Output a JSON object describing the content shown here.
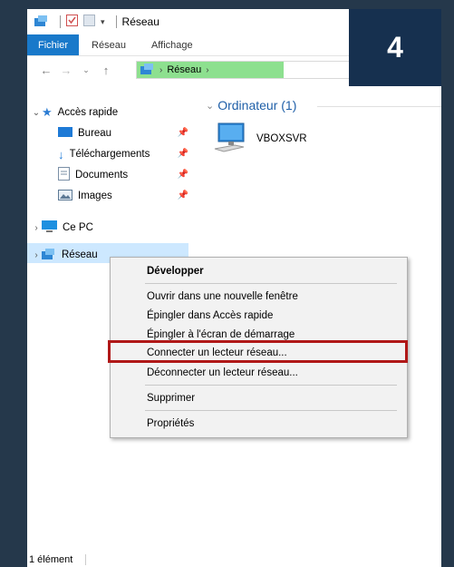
{
  "window": {
    "title": "Réseau"
  },
  "ribbon": {
    "tabs": [
      "Fichier",
      "Réseau",
      "Affichage"
    ]
  },
  "address": {
    "segments": [
      "Réseau"
    ]
  },
  "step_badge": "4",
  "navpane": {
    "quick_access": "Accès rapide",
    "quick_items": [
      "Bureau",
      "Téléchargements",
      "Documents",
      "Images"
    ],
    "this_pc": "Ce PC",
    "network": "Réseau"
  },
  "content": {
    "group_title": "Ordinateur (1)",
    "computer_name": "VBOXSVR"
  },
  "context_menu": {
    "items": [
      "Développer",
      "Ouvrir dans une nouvelle fenêtre",
      "Épingler dans Accès rapide",
      "Épingler à l'écran de démarrage",
      "Connecter un lecteur réseau...",
      "Déconnecter un lecteur réseau...",
      "Supprimer",
      "Propriétés"
    ]
  },
  "status": {
    "count": "1 élément"
  },
  "colors": {
    "accent": "#1979ca",
    "highlight_box": "#b01818",
    "badge_bg": "#16304f",
    "address_fill": "#8de08f"
  }
}
